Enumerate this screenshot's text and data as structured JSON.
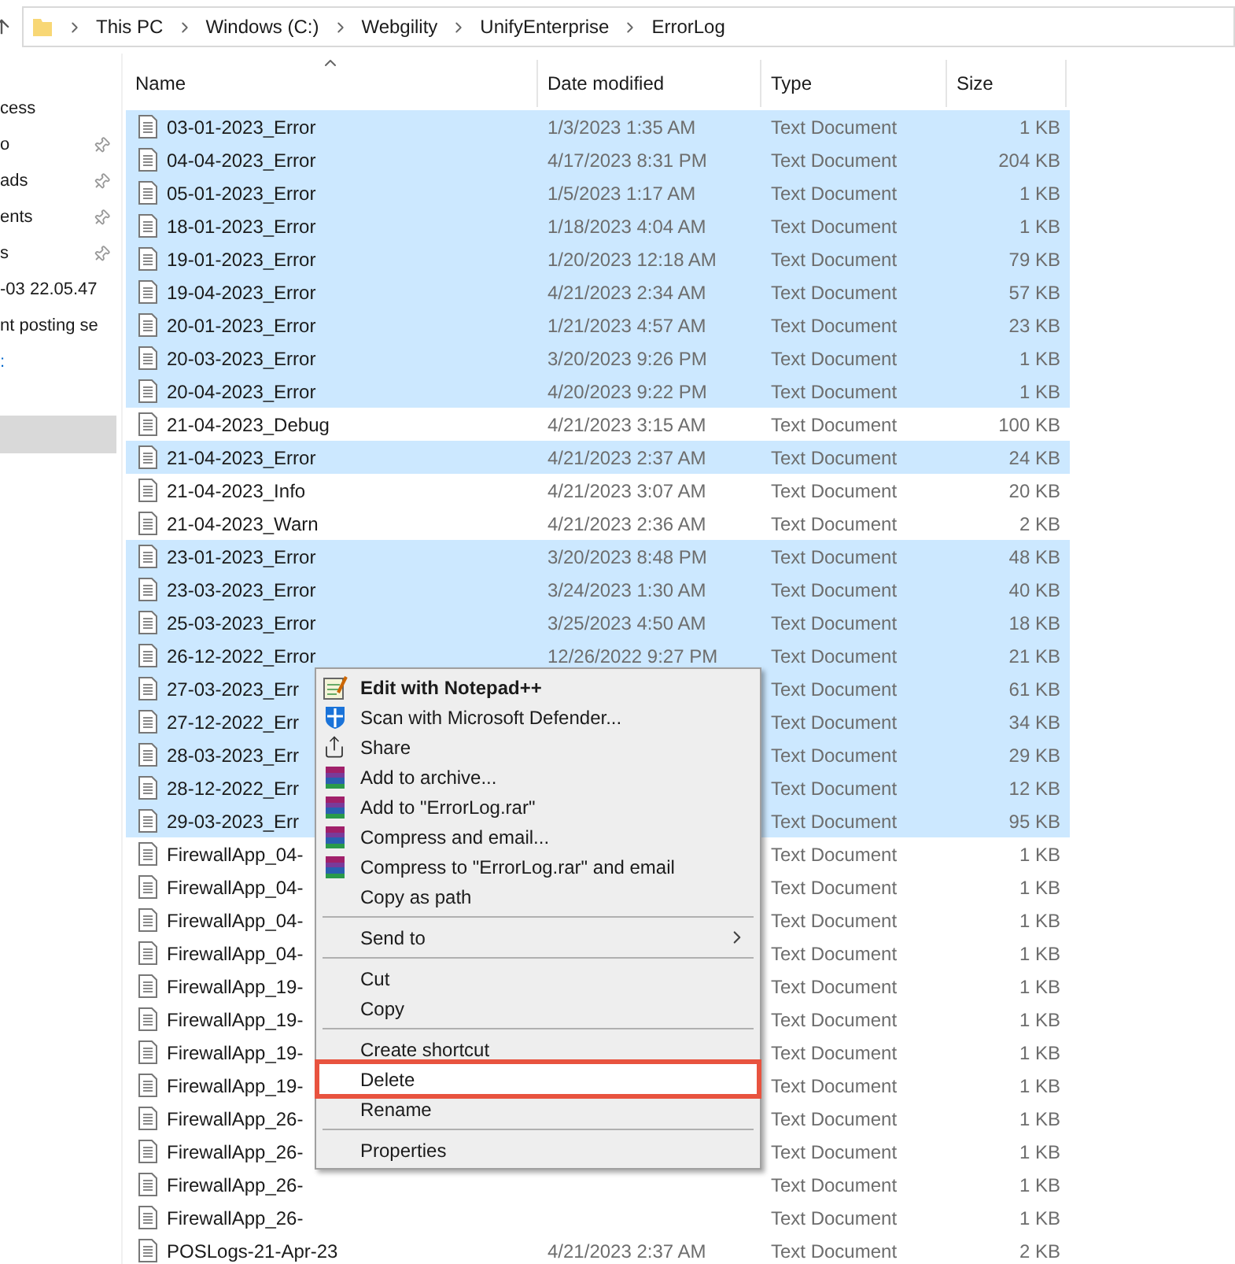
{
  "address_bar": {
    "crumbs": [
      "This PC",
      "Windows (C:)",
      "Webgility",
      "UnifyEnterprise",
      "ErrorLog"
    ]
  },
  "sidebar": {
    "items": [
      {
        "label": "cess",
        "pinned": false,
        "selected": false
      },
      {
        "label": "o",
        "pinned": true,
        "selected": false
      },
      {
        "label": "ads",
        "pinned": true,
        "selected": false
      },
      {
        "label": "ents",
        "pinned": true,
        "selected": false
      },
      {
        "label": "s",
        "pinned": true,
        "selected": false
      },
      {
        "label": "-03 22.05.47",
        "pinned": false,
        "selected": false
      },
      {
        "label": "nt posting se",
        "pinned": false,
        "selected": false
      },
      {
        "label": ":",
        "pinned": false,
        "selected": false,
        "link": true
      },
      {
        "pinned": false,
        "selected": true
      }
    ]
  },
  "table": {
    "columns": [
      "Name",
      "Date modified",
      "Type",
      "Size"
    ],
    "rows": [
      {
        "name": "03-01-2023_Error",
        "date": "1/3/2023 1:35 AM",
        "type": "Text Document",
        "size": "1 KB",
        "selected": true
      },
      {
        "name": "04-04-2023_Error",
        "date": "4/17/2023 8:31 PM",
        "type": "Text Document",
        "size": "204 KB",
        "selected": true
      },
      {
        "name": "05-01-2023_Error",
        "date": "1/5/2023 1:17 AM",
        "type": "Text Document",
        "size": "1 KB",
        "selected": true
      },
      {
        "name": "18-01-2023_Error",
        "date": "1/18/2023 4:04 AM",
        "type": "Text Document",
        "size": "1 KB",
        "selected": true
      },
      {
        "name": "19-01-2023_Error",
        "date": "1/20/2023 12:18 AM",
        "type": "Text Document",
        "size": "79 KB",
        "selected": true
      },
      {
        "name": "19-04-2023_Error",
        "date": "4/21/2023 2:34 AM",
        "type": "Text Document",
        "size": "57 KB",
        "selected": true
      },
      {
        "name": "20-01-2023_Error",
        "date": "1/21/2023 4:57 AM",
        "type": "Text Document",
        "size": "23 KB",
        "selected": true
      },
      {
        "name": "20-03-2023_Error",
        "date": "3/20/2023 9:26 PM",
        "type": "Text Document",
        "size": "1 KB",
        "selected": true
      },
      {
        "name": "20-04-2023_Error",
        "date": "4/20/2023 9:22 PM",
        "type": "Text Document",
        "size": "1 KB",
        "selected": true
      },
      {
        "name": "21-04-2023_Debug",
        "date": "4/21/2023 3:15 AM",
        "type": "Text Document",
        "size": "100 KB",
        "selected": false
      },
      {
        "name": "21-04-2023_Error",
        "date": "4/21/2023 2:37 AM",
        "type": "Text Document",
        "size": "24 KB",
        "selected": true
      },
      {
        "name": "21-04-2023_Info",
        "date": "4/21/2023 3:07 AM",
        "type": "Text Document",
        "size": "20 KB",
        "selected": false
      },
      {
        "name": "21-04-2023_Warn",
        "date": "4/21/2023 2:36 AM",
        "type": "Text Document",
        "size": "2 KB",
        "selected": false
      },
      {
        "name": "23-01-2023_Error",
        "date": "3/20/2023 8:48 PM",
        "type": "Text Document",
        "size": "48 KB",
        "selected": true
      },
      {
        "name": "23-03-2023_Error",
        "date": "3/24/2023 1:30 AM",
        "type": "Text Document",
        "size": "40 KB",
        "selected": true
      },
      {
        "name": "25-03-2023_Error",
        "date": "3/25/2023 4:50 AM",
        "type": "Text Document",
        "size": "18 KB",
        "selected": true
      },
      {
        "name": "26-12-2022_Error",
        "date": "12/26/2022 9:27 PM",
        "type": "Text Document",
        "size": "21 KB",
        "selected": true
      },
      {
        "name": "27-03-2023_Err",
        "type": "Text Document",
        "size": "61 KB",
        "selected": true
      },
      {
        "name": "27-12-2022_Err",
        "type": "Text Document",
        "size": "34 KB",
        "selected": true
      },
      {
        "name": "28-03-2023_Err",
        "type": "Text Document",
        "size": "29 KB",
        "selected": true
      },
      {
        "name": "28-12-2022_Err",
        "type": "Text Document",
        "size": "12 KB",
        "selected": true
      },
      {
        "name": "29-03-2023_Err",
        "type": "Text Document",
        "size": "95 KB",
        "selected": true
      },
      {
        "name": "FirewallApp_04-",
        "type": "Text Document",
        "size": "1 KB",
        "selected": false
      },
      {
        "name": "FirewallApp_04-",
        "type": "Text Document",
        "size": "1 KB",
        "selected": false
      },
      {
        "name": "FirewallApp_04-",
        "type": "Text Document",
        "size": "1 KB",
        "selected": false
      },
      {
        "name": "FirewallApp_04-",
        "type": "Text Document",
        "size": "1 KB",
        "selected": false
      },
      {
        "name": "FirewallApp_19-",
        "type": "Text Document",
        "size": "1 KB",
        "selected": false
      },
      {
        "name": "FirewallApp_19-",
        "type": "Text Document",
        "size": "1 KB",
        "selected": false
      },
      {
        "name": "FirewallApp_19-",
        "type": "Text Document",
        "size": "1 KB",
        "selected": false
      },
      {
        "name": "FirewallApp_19-",
        "type": "Text Document",
        "size": "1 KB",
        "selected": false
      },
      {
        "name": "FirewallApp_26-",
        "type": "Text Document",
        "size": "1 KB",
        "selected": false
      },
      {
        "name": "FirewallApp_26-",
        "type": "Text Document",
        "size": "1 KB",
        "selected": false
      },
      {
        "name": "FirewallApp_26-",
        "type": "Text Document",
        "size": "1 KB",
        "selected": false
      },
      {
        "name": "FirewallApp_26-",
        "type": "Text Document",
        "size": "1 KB",
        "selected": false
      },
      {
        "name": "POSLogs-21-Apr-23",
        "date": "4/21/2023 2:37 AM",
        "type": "Text Document",
        "size": "2 KB",
        "selected": false
      }
    ]
  },
  "context_menu": {
    "items": [
      {
        "kind": "notepad",
        "label": "Edit with Notepad++",
        "selected": false
      },
      {
        "kind": "defender",
        "label": "Scan with Microsoft Defender...",
        "selected": false
      },
      {
        "kind": "share",
        "label": "Share",
        "selected": false
      },
      {
        "kind": "archive",
        "label": "Add to archive...",
        "selected": false
      },
      {
        "kind": "archive",
        "label": "Add to \"ErrorLog.rar\"",
        "selected": false
      },
      {
        "kind": "archive",
        "label": "Compress and email...",
        "selected": false
      },
      {
        "kind": "archive",
        "label": "Compress to \"ErrorLog.rar\" and email",
        "selected": false
      },
      {
        "kind": "plain",
        "label": "Copy as path",
        "selected": false
      },
      {
        "kind": "separator"
      },
      {
        "kind": "submenu",
        "label": "Send to",
        "selected": false
      },
      {
        "kind": "separator"
      },
      {
        "kind": "plain",
        "label": "Cut",
        "selected": false
      },
      {
        "kind": "plain",
        "label": "Copy",
        "selected": false
      },
      {
        "kind": "separator"
      },
      {
        "kind": "plain",
        "label": "Create shortcut",
        "selected": false
      },
      {
        "kind": "plain",
        "label": "Delete",
        "selected": true
      },
      {
        "kind": "plain",
        "label": "Rename",
        "selected": false
      },
      {
        "kind": "separator"
      },
      {
        "kind": "plain",
        "label": "Properties",
        "selected": false
      }
    ]
  }
}
